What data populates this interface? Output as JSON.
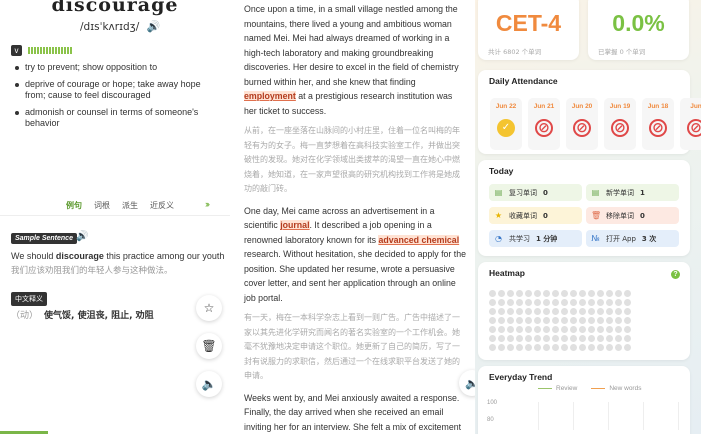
{
  "word": {
    "headword": "discourage",
    "phonetic": "/dɪsˈkʌrɪdʒ/",
    "pos": "v",
    "definitions": [
      "try to prevent; show opposition to",
      "deprive of courage or hope; take away hope from; cause to feel discouraged",
      "admonish or counsel in terms of someone's behavior"
    ],
    "tabs": [
      "例句",
      "词根",
      "派生",
      "近反义"
    ],
    "sample_tag": "Sample Sentence",
    "sample_before": "We should ",
    "sample_word": "discourage",
    "sample_after": " this practice among our youth",
    "sample_zh": "我们应该劝阻我们的年轻人参与这种做法。",
    "zh_tag": "中文释义",
    "zh_pos": "（动）",
    "zh_def": "使气馁, 使沮丧, 阻止, 劝阻"
  },
  "story": {
    "p1_a": "Once upon a time, in a small village nestled among the mountains, there lived a young and ambitious woman named Mei. Mei had always dreamed of working in a high-tech laboratory and making groundbreaking discoveries. Her desire to excel in the field of chemistry burned within her, and she knew that finding ",
    "p1_hl": "employment",
    "p1_b": " at a prestigious research institution was her ticket to success.",
    "p1_zh": "从前，在一座坐落在山脉间的小村庄里，住着一位名叫梅的年轻有为的女子。梅一直梦想着在高科技实验室工作，并做出突破性的发现。她对在化学领域出类拔萃的渴望一直在她心中燃烧着，她知道，在一家声望很高的研究机构找到工作将是她成功的敲门砖。",
    "p2_a": "One day, Mei came across an advertisement in a scientific ",
    "p2_hl1": "journal",
    "p2_b": ". It described a job opening in a renowned laboratory known for its ",
    "p2_hl2": "advanced chemical",
    "p2_c": " research. Without hesitation, she decided to apply for the position. She updated her resume, wrote a persuasive cover letter, and sent her application through an online job portal.",
    "p2_zh": "有一天，梅在一本科学杂志上看到一则广告。广告中描述了一家以其先进化学研究而闻名的著名实验室的一个工作机会。她毫不犹豫地决定申请这个职位。她更新了自己的简历，写了一封有说服力的求职信，然后通过一个在线求职平台发送了她的申请。",
    "p3": "Weeks went by, and Mei anxiously awaited a response. Finally, the day arrived when she received an email inviting her for an interview. She felt a mix of excitement and nervousness, realizing that this opportunity could"
  },
  "stats": {
    "level": "CET-4",
    "level_sub": "共计 6802 个单词",
    "progress": "0.0%",
    "progress_sub": "已掌握 0 个单词"
  },
  "attendance": {
    "title": "Daily Attendance",
    "days": [
      {
        "date": "Jun 22",
        "status": "done"
      },
      {
        "date": "Jun 21",
        "status": "missed"
      },
      {
        "date": "Jun 20",
        "status": "missed"
      },
      {
        "date": "Jun 19",
        "status": "missed"
      },
      {
        "date": "Jun 18",
        "status": "missed"
      },
      {
        "date": "Jun",
        "status": "missed"
      }
    ]
  },
  "today": {
    "title": "Today",
    "items": [
      {
        "icon": "book-icon",
        "glyph": "▤",
        "label": "复习单词",
        "value": "0",
        "bg": "#eef6e6",
        "color": "#6aa84f"
      },
      {
        "icon": "book-plus-icon",
        "glyph": "▤",
        "label": "新学单词",
        "value": "1",
        "bg": "#eef6e6",
        "color": "#6aa84f"
      },
      {
        "icon": "star-icon",
        "glyph": "★",
        "label": "收藏单词",
        "value": "0",
        "bg": "#fdf4d8",
        "color": "#e8b400"
      },
      {
        "icon": "trash-icon",
        "glyph": "🗑",
        "label": "移除单词",
        "value": "0",
        "bg": "#fde9e2",
        "color": "#e07050"
      },
      {
        "icon": "clock-icon",
        "glyph": "◔",
        "label": "共学习",
        "value": "1 分钟",
        "bg": "#e4eefa",
        "color": "#3a78c8"
      },
      {
        "icon": "number-icon",
        "glyph": "№",
        "label": "打开 App",
        "value": "3 次",
        "bg": "#e4eefa",
        "color": "#3a78c8"
      }
    ]
  },
  "heatmap": {
    "title": "Heatmap"
  },
  "trend": {
    "title": "Everyday Trend",
    "legend": [
      {
        "name": "Review",
        "color": "#9bc46b"
      },
      {
        "name": "New words",
        "color": "#f0a050"
      }
    ],
    "yticks": [
      "100",
      "80"
    ]
  }
}
